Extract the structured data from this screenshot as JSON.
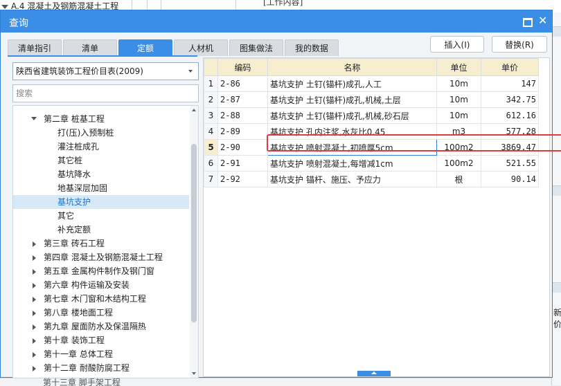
{
  "background": {
    "top_node": "A.4  混凝土及钢筋混凝土工程",
    "work_content": "[工作内容]",
    "right_partial": "新价",
    "bottom_text": "第十三章 脚手架工程"
  },
  "dialog": {
    "title": "查询",
    "tabs": [
      "清单指引",
      "清单",
      "定额",
      "人材机",
      "图集做法",
      "我的数据"
    ],
    "active_tab": "定额",
    "insert_label": "插入(I)",
    "replace_label": "替换(R)",
    "library": "陕西省建筑装饰工程价目表(2009)",
    "search_placeholder": "搜索",
    "tree": [
      {
        "label": "第二章 桩基工程",
        "expand": "open"
      },
      {
        "label": "打(压)入预制桩"
      },
      {
        "label": "灌注桩成孔"
      },
      {
        "label": "其它桩"
      },
      {
        "label": "基坑降水"
      },
      {
        "label": "地基深层加固"
      },
      {
        "label": "基坑支护",
        "selected": true
      },
      {
        "label": "其它"
      },
      {
        "label": "补充定额"
      },
      {
        "label": "第三章 砖石工程",
        "expand": "closed"
      },
      {
        "label": "第四章 混凝土及钢筋混凝土工程",
        "expand": "closed"
      },
      {
        "label": "第五章 金属构件制作及钢门窗",
        "expand": "closed"
      },
      {
        "label": "第六章 构件运输及安装",
        "expand": "closed"
      },
      {
        "label": "第七章 木门窗和木结构工程",
        "expand": "closed"
      },
      {
        "label": "第八章 楼地面工程",
        "expand": "closed"
      },
      {
        "label": "第九章 屋面防水及保温隔热",
        "expand": "closed"
      },
      {
        "label": "第十章 装饰工程",
        "expand": "closed"
      },
      {
        "label": "第十一章 总体工程",
        "expand": "closed"
      },
      {
        "label": "第十二章 耐酸防腐工程",
        "expand": "closed"
      },
      {
        "label": "第十三章 脚手架工程",
        "expand": "closed"
      }
    ],
    "table": {
      "headers": [
        "编码",
        "名称",
        "单位",
        "单价"
      ],
      "rows": [
        {
          "idx": "1",
          "code": "2-86",
          "name": "基坑支护 土钉(锚杆)成孔,人工",
          "unit": "10m",
          "price": "147"
        },
        {
          "idx": "2",
          "code": "2-87",
          "name": "基坑支护 土钉(锚杆)成孔,机械,土层",
          "unit": "10m",
          "price": "342.75"
        },
        {
          "idx": "3",
          "code": "2-88",
          "name": "基坑支护 土钉(锚杆)成孔,机械,砂石层",
          "unit": "10m",
          "price": "612.16"
        },
        {
          "idx": "4",
          "code": "2-89",
          "name": "基坑支护 孔内注浆,水灰比0.45",
          "unit": "m3",
          "price": "577.28"
        },
        {
          "idx": "5",
          "code": "2-90",
          "name": "基坑支护 喷射混凝土,初喷厚5cm",
          "unit": "100m2",
          "price": "3869.47",
          "selected": true
        },
        {
          "idx": "6",
          "code": "2-91",
          "name": "基坑支护 喷射混凝土,每增减1cm",
          "unit": "100m2",
          "price": "521.55"
        },
        {
          "idx": "7",
          "code": "2-92",
          "name": "基坑支护 锚杆、施压、予应力",
          "unit": "根",
          "price": "90.14"
        }
      ]
    }
  },
  "colors": {
    "accent": "#3a8ee6",
    "header_bg": "#f7eecf",
    "highlight_border": "#e03a3a"
  }
}
